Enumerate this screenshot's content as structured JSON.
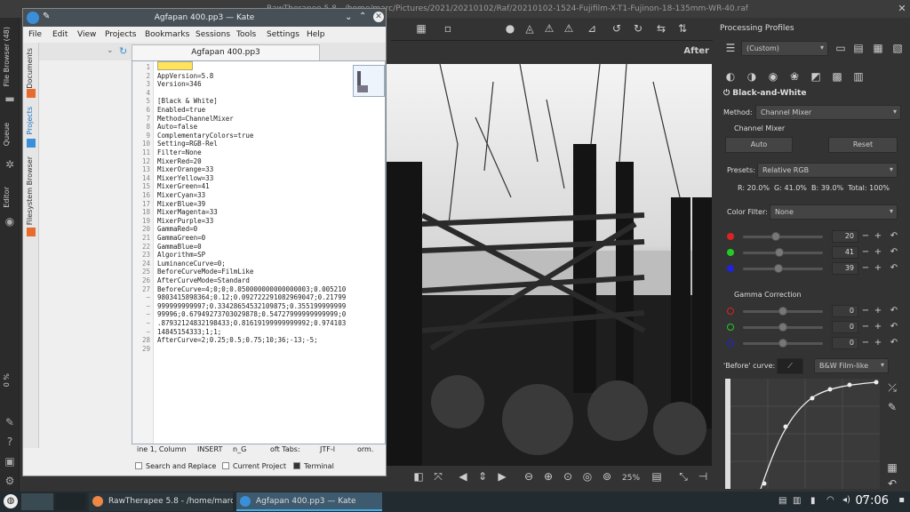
{
  "rt": {
    "title": "RawTherapee 5.8 - /home/marc/Pictures/2021/20210102/Raf/20210102-1524-Fujifilm-X-T1-Fujinon-18-135mm-WR-40.raf",
    "left_tabs": [
      "File Browser (48)",
      "Queue",
      "Editor"
    ],
    "progress": "0 %",
    "after_label": "After",
    "zoom": "25%",
    "panel": {
      "processing_profiles_label": "Processing Profiles",
      "profile_value": "(Custom)",
      "section_title": "Black-and-White",
      "method_label": "Method:",
      "method_value": "Channel Mixer",
      "channel_mixer_label": "Channel Mixer",
      "auto_label": "Auto",
      "reset_label": "Reset",
      "presets_label": "Presets:",
      "presets_value": "Relative RGB",
      "rgb_summary": "R: 20.0%  G: 41.0%  B: 39.0%  Total: 100%",
      "color_filter_label": "Color Filter:",
      "color_filter_value": "None",
      "mixer_red": "20",
      "mixer_green": "41",
      "mixer_blue": "39",
      "gamma_label": "Gamma Correction",
      "gamma_red": "0",
      "gamma_green": "0",
      "gamma_blue": "0",
      "before_curve_label": "'Before' curve:",
      "before_curve_value": "B&W Film-like"
    }
  },
  "kate": {
    "title": "Agfapan 400.pp3 — Kate",
    "menu": [
      "File",
      "Edit",
      "View",
      "Projects",
      "Bookmarks",
      "Sessions",
      "Tools",
      "Settings",
      "Help"
    ],
    "side_tabs": [
      "Documents",
      "Projects",
      "Filesystem Browser"
    ],
    "tab_label": "Agfapan 400.pp3",
    "lines": [
      {
        "n": "1",
        "t": "[Version]"
      },
      {
        "n": "2",
        "t": "AppVersion=5.8"
      },
      {
        "n": "3",
        "t": "Version=346"
      },
      {
        "n": "4",
        "t": ""
      },
      {
        "n": "5",
        "t": "[Black & White]"
      },
      {
        "n": "6",
        "t": "Enabled=true"
      },
      {
        "n": "7",
        "t": "Method=ChannelMixer"
      },
      {
        "n": "8",
        "t": "Auto=false"
      },
      {
        "n": "9",
        "t": "ComplementaryColors=true"
      },
      {
        "n": "10",
        "t": "Setting=RGB-Rel"
      },
      {
        "n": "11",
        "t": "Filter=None"
      },
      {
        "n": "12",
        "t": "MixerRed=20"
      },
      {
        "n": "13",
        "t": "MixerOrange=33"
      },
      {
        "n": "14",
        "t": "MixerYellow=33"
      },
      {
        "n": "15",
        "t": "MixerGreen=41"
      },
      {
        "n": "16",
        "t": "MixerCyan=33"
      },
      {
        "n": "17",
        "t": "MixerBlue=39"
      },
      {
        "n": "18",
        "t": "MixerMagenta=33"
      },
      {
        "n": "19",
        "t": "MixerPurple=33"
      },
      {
        "n": "20",
        "t": "GammaRed=0"
      },
      {
        "n": "21",
        "t": "GammaGreen=0"
      },
      {
        "n": "22",
        "t": "GammaBlue=0"
      },
      {
        "n": "23",
        "t": "Algorithm=SP"
      },
      {
        "n": "24",
        "t": "LuminanceCurve=0;"
      },
      {
        "n": "25",
        "t": "BeforeCurveMode=FilmLike"
      },
      {
        "n": "26",
        "t": "AfterCurveMode=Standard"
      },
      {
        "n": "27",
        "t": "BeforeCurve=4;0;0;0.050000000000000003;0.005210"
      },
      {
        "n": "~",
        "t": "9803415898364;0.12;0.092722291082969047;0.21799"
      },
      {
        "n": "~",
        "t": "999999999997;0.33428654532109875;0.355199999999"
      },
      {
        "n": "~",
        "t": "99996;0.67949273703029878;0.54727999999999999;0"
      },
      {
        "n": "~",
        "t": ".87932124832198433;0.81619199999999992;0.974103"
      },
      {
        "n": "~",
        "t": "14845154333;1;1;"
      },
      {
        "n": "28",
        "t": "AfterCurve=2;0.25;0.5;0.75;10;36;-13;-5;"
      },
      {
        "n": "29",
        "t": ""
      }
    ],
    "status": {
      "position": "ine 1, Column",
      "mode": "INSERT",
      "lang": "n_G",
      "tabs": "oft Tabs:",
      "encoding": "JTF-l",
      "format": "orm."
    },
    "bottom": {
      "search": "Search and Replace",
      "project": "Current Project",
      "terminal": "Terminal"
    }
  },
  "taskbar": {
    "task1": "RawTherapee 5.8 - /home/marc/Pi...",
    "task2": "Agfapan 400.pp3  — Kate",
    "clock": "07:06"
  }
}
